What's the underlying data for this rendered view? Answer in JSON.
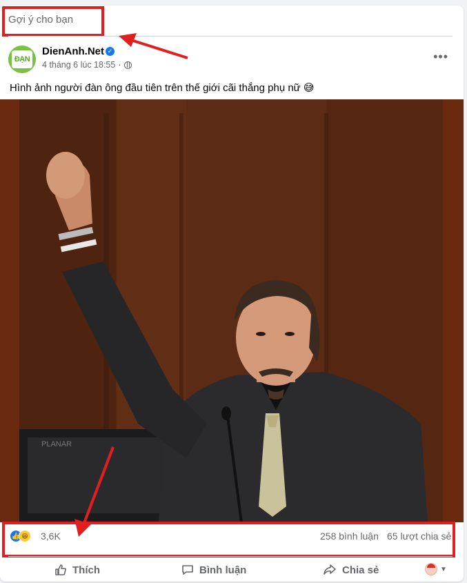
{
  "feed": {
    "suggestion_label": "Gợi ý cho bạn"
  },
  "post": {
    "author": {
      "name": "DienAnh.Net",
      "avatar_text": "ĐẠN",
      "verified_icon": "verified-badge-icon"
    },
    "timestamp": "4 tháng 6 lúc 18:55",
    "separator": "·",
    "privacy_icon": "globe-icon",
    "more_icon": "more-options-icon",
    "more_text": "•••",
    "caption": "Hình ảnh người đàn ông đầu tiên trên thế giới cãi thắng phụ nữ 😅",
    "image_icon": "photo-man-raising-fist"
  },
  "stats": {
    "reaction_icons": [
      "like-reaction-icon",
      "haha-reaction-icon"
    ],
    "reaction_count": "3,6K",
    "comment_count": "258 bình luận",
    "share_count": "65 lượt chia sẻ"
  },
  "actions": {
    "like_label": "Thích",
    "comment_label": "Bình luận",
    "share_label": "Chia sẻ",
    "audience_caret": "▼"
  },
  "colors": {
    "annotation": "#e02020",
    "brand_blue": "#1877f2",
    "avatar_green": "#7ac143"
  }
}
